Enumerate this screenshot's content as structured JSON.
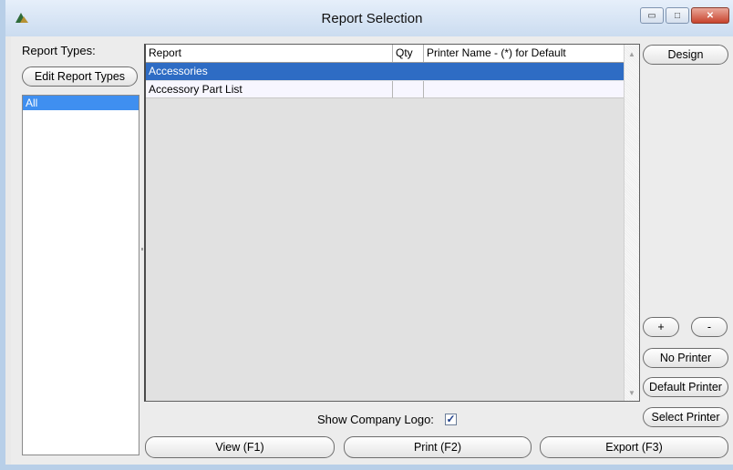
{
  "window": {
    "title": "Report Selection",
    "minimize_glyph": "▭",
    "maximize_glyph": "□",
    "close_glyph": "✕"
  },
  "left": {
    "report_types_label": "Report Types:",
    "edit_button": "Edit Report Types",
    "types": [
      "All"
    ],
    "selected_type": "All"
  },
  "grid": {
    "columns": [
      "Report",
      "Qty",
      "Printer Name - (*) for Default"
    ],
    "rows": [
      {
        "report": "Accessories",
        "qty": "",
        "printer": ""
      },
      {
        "report": "Accessory Part List",
        "qty": "",
        "printer": ""
      }
    ],
    "selected_row": "Accessories",
    "scroll_up": "▲",
    "scroll_down": "▼"
  },
  "right": {
    "design": "Design",
    "plus": "+",
    "minus": "-",
    "no_printer": "No Printer",
    "default_printer": "Default Printer",
    "select_printer": "Select Printer"
  },
  "bottom": {
    "show_logo_label": "Show Company Logo:",
    "show_logo_checked": true,
    "check_glyph": "✓",
    "view": "View (F1)",
    "print": "Print (F2)",
    "export": "Export (F3)"
  },
  "colors": {
    "selection": "#2e6cc4",
    "list_selection": "#3f8ff0",
    "frame": "#b8cfe8"
  },
  "icons": {
    "app": "triangle-app-icon"
  }
}
